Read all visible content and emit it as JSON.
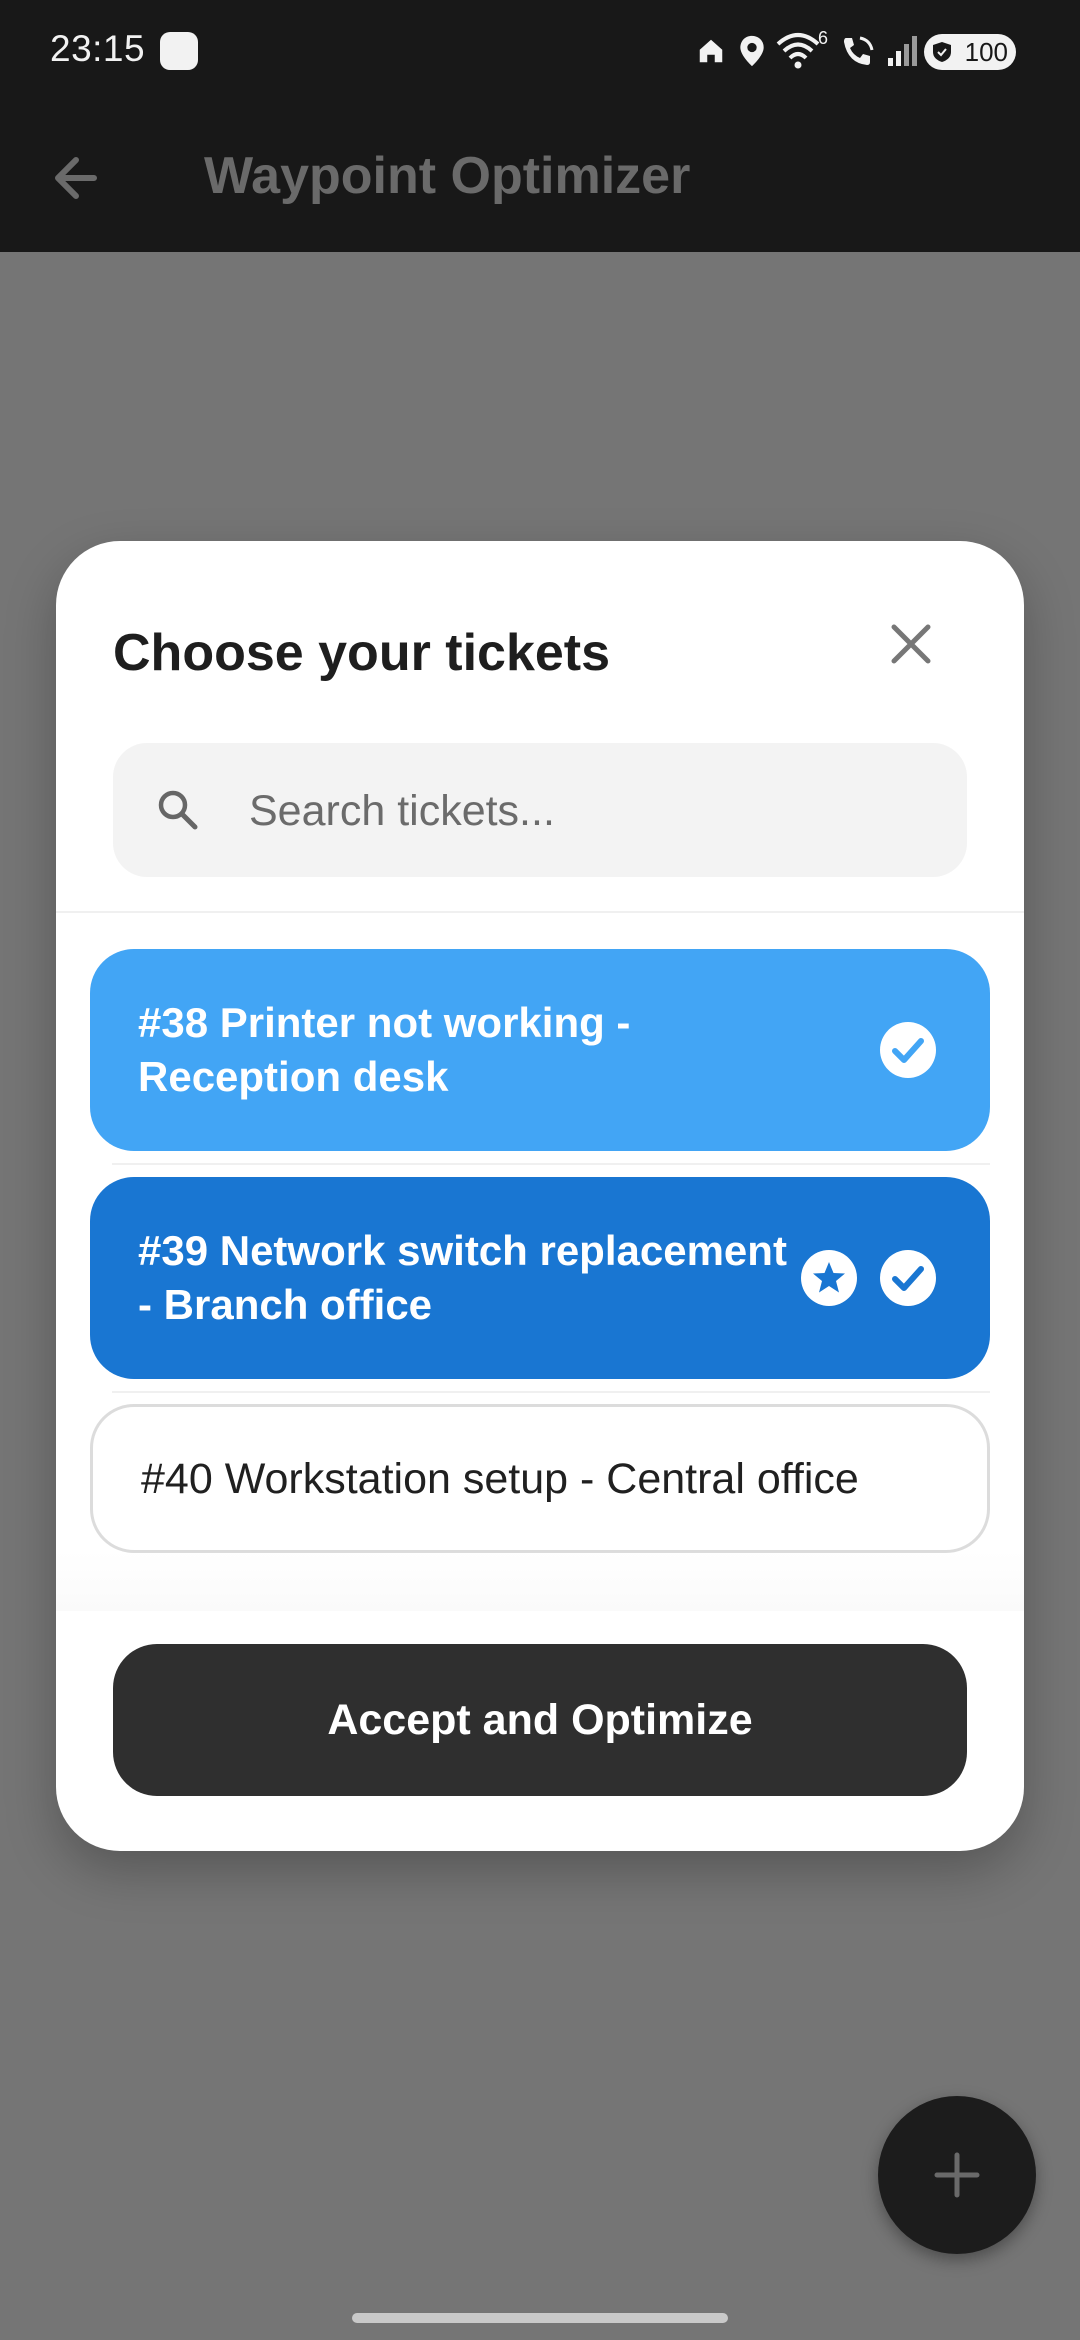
{
  "status_bar": {
    "time": "23:15",
    "wifi_badge": "6",
    "battery": "100",
    "icons": [
      "notification-icon",
      "home-icon",
      "location-icon",
      "wifi-icon",
      "wifi-calling-icon",
      "signal-icon",
      "battery-icon"
    ]
  },
  "app_bar": {
    "title": "Waypoint Optimizer",
    "back_icon": "arrow-left-icon"
  },
  "dialog": {
    "title": "Choose your tickets",
    "close_icon": "close-icon",
    "search": {
      "placeholder": "Search tickets...",
      "value": "",
      "icon": "search-icon"
    },
    "tickets": [
      {
        "label": "#38 Printer not working - Reception desk",
        "selected": true,
        "starred": false,
        "color": "#42a5f5"
      },
      {
        "label": "#39 Network switch replacement - Branch office",
        "selected": true,
        "starred": true,
        "color": "#1976d2"
      },
      {
        "label": "#40 Workstation setup - Central office",
        "selected": false,
        "starred": false,
        "color": "#ffffff"
      }
    ],
    "accept_label": "Accept and Optimize"
  },
  "fab": {
    "icon": "plus-icon"
  },
  "colors": {
    "overlay": "#757575",
    "bar": "#181818",
    "selected_light": "#42a5f5",
    "selected_dark": "#1976d2",
    "button": "#2f2f2f"
  }
}
